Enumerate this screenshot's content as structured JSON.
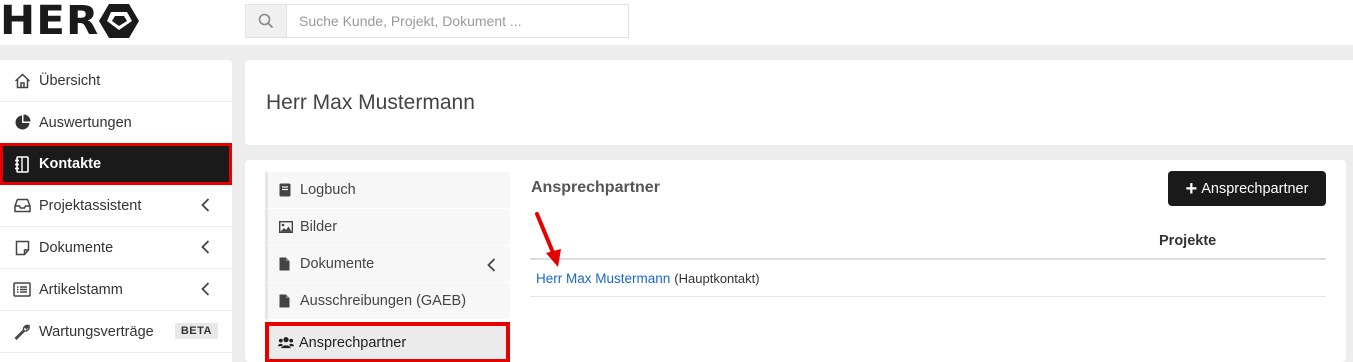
{
  "app": {
    "logo_text": "HER"
  },
  "search": {
    "placeholder": "Suche Kunde, Projekt, Dokument ..."
  },
  "sidebar": {
    "items": [
      {
        "label": "Übersicht",
        "icon": "home-icon"
      },
      {
        "label": "Auswertungen",
        "icon": "pie-chart-icon"
      },
      {
        "label": "Kontakte",
        "icon": "address-book-icon",
        "active": true
      },
      {
        "label": "Projektassistent",
        "icon": "inbox-icon",
        "expandable": true
      },
      {
        "label": "Dokumente",
        "icon": "document-icon",
        "expandable": true
      },
      {
        "label": "Artikelstamm",
        "icon": "list-icon",
        "expandable": true
      },
      {
        "label": "Wartungsverträge",
        "icon": "wrench-icon",
        "badge": "BETA"
      }
    ]
  },
  "header": {
    "title": "Herr Max Mustermann"
  },
  "subnav": {
    "items": [
      {
        "label": "Logbuch",
        "icon": "book-icon"
      },
      {
        "label": "Bilder",
        "icon": "image-icon"
      },
      {
        "label": "Dokumente",
        "icon": "file-icon",
        "expandable": true
      },
      {
        "label": "Ausschreibungen (GAEB)",
        "icon": "file-icon"
      },
      {
        "label": "Ansprechpartner",
        "icon": "users-icon",
        "active": true
      }
    ]
  },
  "content": {
    "section_title": "Ansprechpartner",
    "add_button_label": "Ansprechpartner",
    "table": {
      "columns": [
        "",
        "Projekte"
      ],
      "rows": [
        {
          "name": "Herr Max Mustermann",
          "tag": "(Hauptkontakt)",
          "projects": ""
        }
      ]
    }
  },
  "colors": {
    "highlight": "#e60000",
    "dark": "#1a1a1a",
    "link": "#1a66cc"
  }
}
